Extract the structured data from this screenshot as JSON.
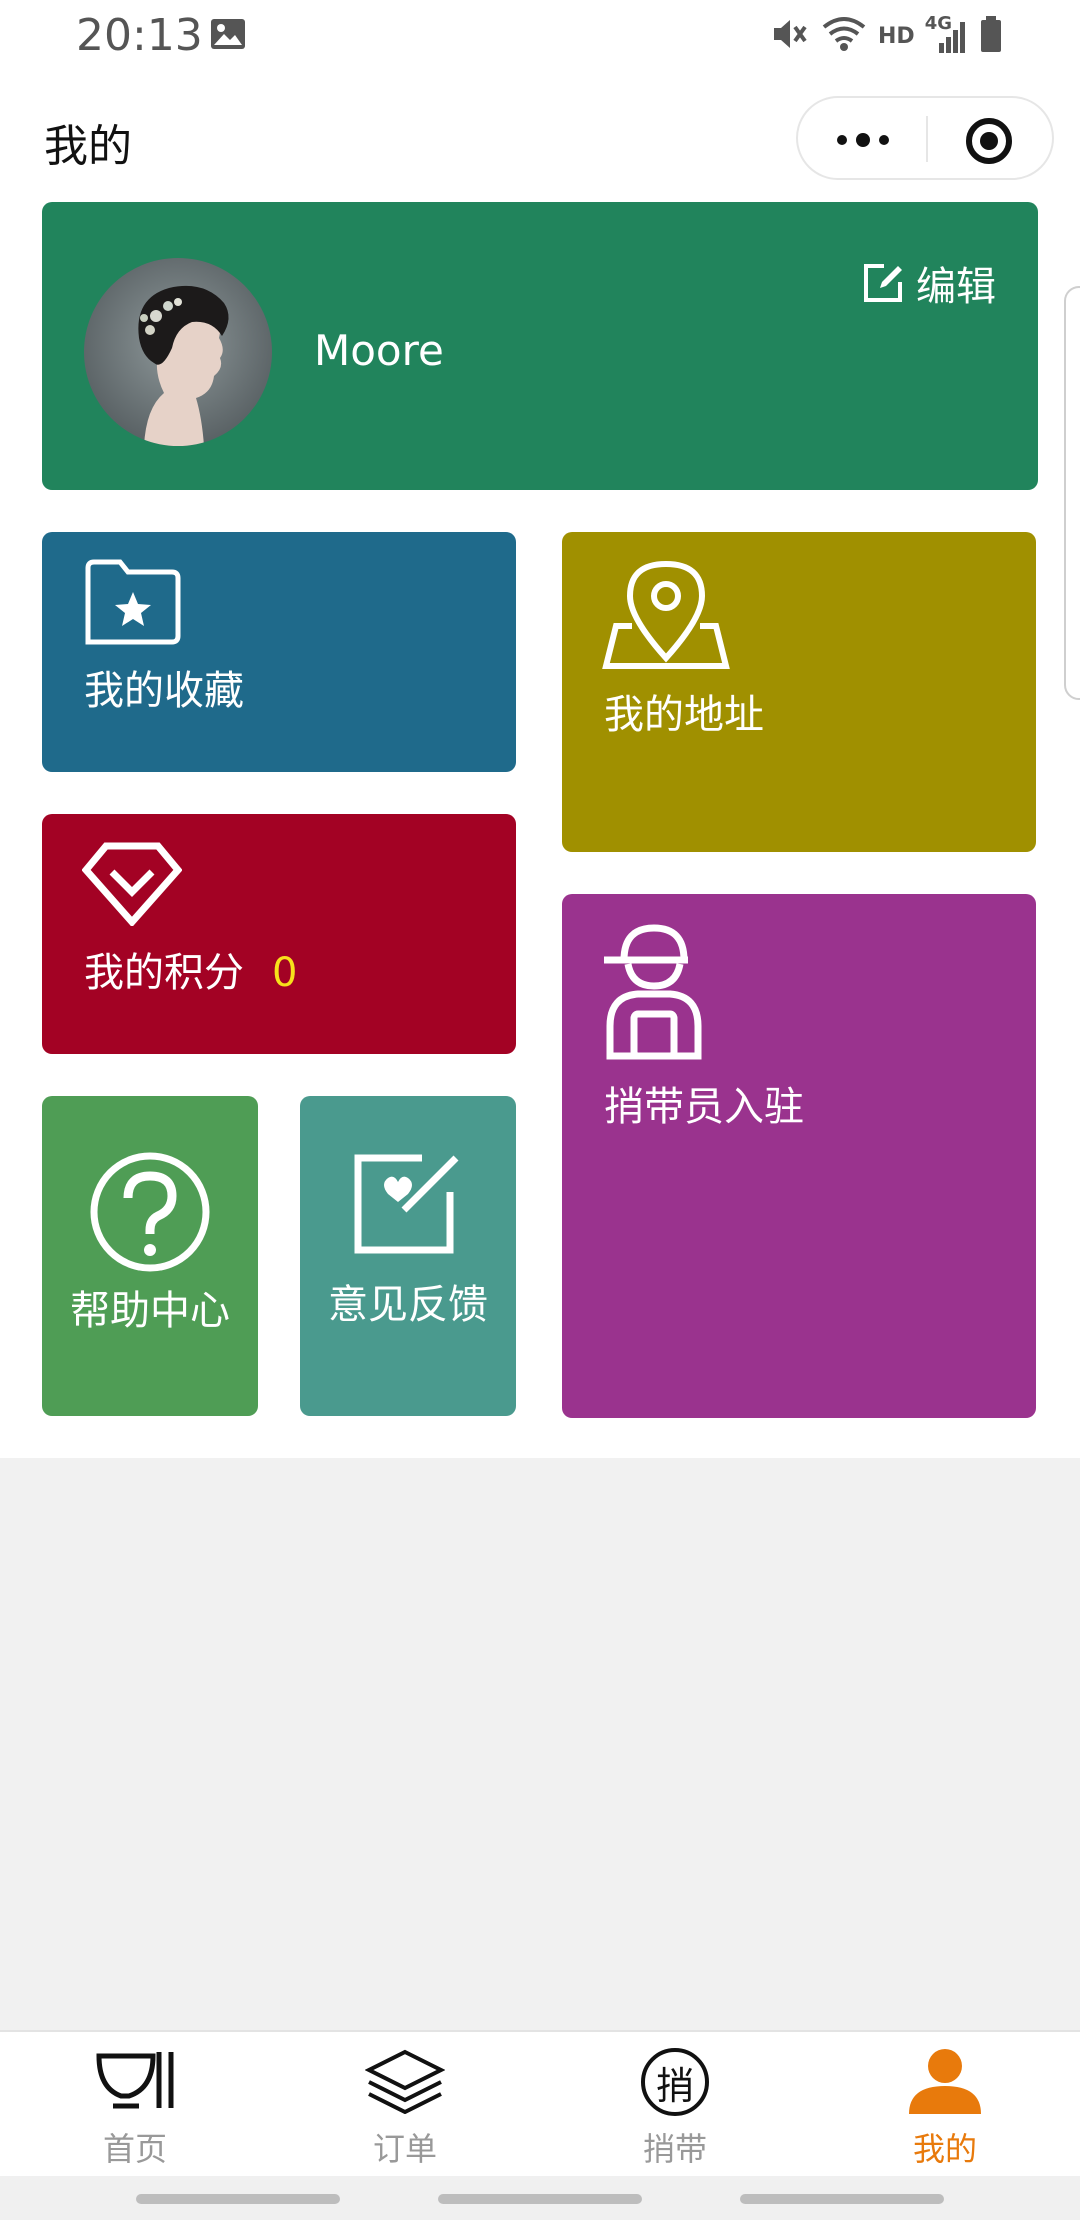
{
  "status_bar": {
    "time": "20:13",
    "network_label": "HD",
    "signal_label": "4G"
  },
  "nav": {
    "title": "我的"
  },
  "profile": {
    "username": "Moore",
    "edit_label": "编辑"
  },
  "tiles": {
    "favorites": "我的收藏",
    "address": "我的地址",
    "points_label": "我的积分",
    "points_value": "0",
    "courier": "捎带员入驻",
    "help": "帮助中心",
    "feedback": "意见反馈"
  },
  "tabbar": {
    "items": [
      {
        "label": "首页",
        "icon": "bowl-chopsticks-icon"
      },
      {
        "label": "订单",
        "icon": "layers-icon"
      },
      {
        "label": "捎带",
        "icon": "shao-char-icon",
        "glyph": "捎"
      },
      {
        "label": "我的",
        "icon": "user-icon",
        "active": true
      }
    ]
  },
  "colors": {
    "profile_bg": "#21845c",
    "favorites_bg": "#1f6a8b",
    "address_bg": "#a09000",
    "points_bg": "#a30224",
    "courier_bg": "#9a338e",
    "help_bg": "#4f9d55",
    "feedback_bg": "#4a9a8e",
    "active_tab": "#e87a0c",
    "points_value": "#f7e11b"
  }
}
